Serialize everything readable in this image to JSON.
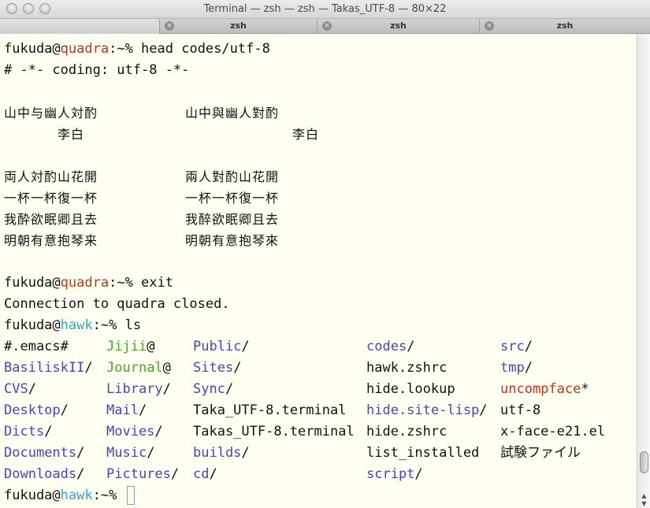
{
  "window": {
    "title": "Terminal — zsh — zsh — Takas_UTF-8 — 80×22"
  },
  "tabs": [
    {
      "label": ""
    },
    {
      "label": "zsh"
    },
    {
      "label": "zsh"
    },
    {
      "label": "zsh"
    }
  ],
  "session": {
    "user": "fukuda",
    "at": "@",
    "remote_host": "quadra",
    "local_host": "hawk",
    "prompt_suffix": ":~%",
    "cmd_head": " head codes/utf-8",
    "coding_line": "# -*- coding: utf-8 -*-",
    "cmd_exit": " exit",
    "connection_closed": "Connection to quadra closed.",
    "cmd_ls": " ls"
  },
  "poem": {
    "left": [
      "山中与幽人対酌",
      "　　　　李白",
      "",
      "両人対酌山花開",
      "一杯一杯復一杯",
      "我酔欲眠卿且去",
      "明朝有意抱琴来"
    ],
    "right": [
      "山中與幽人對酌",
      "　　　　　　　　李白",
      "",
      "兩人對酌山花開",
      "一杯一杯復一杯",
      "我醉欲眠卿且去",
      "明朝有意抱琴來"
    ]
  },
  "ls": {
    "rows": [
      [
        {
          "name": "#.emacs#",
          "suffix": "",
          "color": "black"
        },
        {
          "name": "Jijii",
          "suffix": "@",
          "color": "green"
        },
        {
          "name": "Public",
          "suffix": "/",
          "color": "blue"
        },
        {
          "name": "codes",
          "suffix": "/",
          "color": "blue"
        },
        {
          "name": "src",
          "suffix": "/",
          "color": "blue"
        }
      ],
      [
        {
          "name": "BasiliskII",
          "suffix": "/",
          "color": "blue"
        },
        {
          "name": "Journal",
          "suffix": "@",
          "color": "green"
        },
        {
          "name": "Sites",
          "suffix": "/",
          "color": "blue"
        },
        {
          "name": "hawk.zshrc",
          "suffix": "",
          "color": "black"
        },
        {
          "name": "tmp",
          "suffix": "/",
          "color": "blue"
        }
      ],
      [
        {
          "name": "CVS",
          "suffix": "/",
          "color": "blue"
        },
        {
          "name": "Library",
          "suffix": "/",
          "color": "blue"
        },
        {
          "name": "Sync",
          "suffix": "/",
          "color": "blue"
        },
        {
          "name": "hide.lookup",
          "suffix": "",
          "color": "black"
        },
        {
          "name": "uncompface",
          "suffix": "*",
          "color": "red"
        }
      ],
      [
        {
          "name": "Desktop",
          "suffix": "/",
          "color": "blue"
        },
        {
          "name": "Mail",
          "suffix": "/",
          "color": "blue"
        },
        {
          "name": "Taka_UTF-8.terminal",
          "suffix": "",
          "color": "black"
        },
        {
          "name": "hide.site-lisp",
          "suffix": "/",
          "color": "blue"
        },
        {
          "name": "utf-8",
          "suffix": "",
          "color": "black"
        }
      ],
      [
        {
          "name": "Dicts",
          "suffix": "/",
          "color": "blue"
        },
        {
          "name": "Movies",
          "suffix": "/",
          "color": "blue"
        },
        {
          "name": "Takas_UTF-8.terminal",
          "suffix": "",
          "color": "black"
        },
        {
          "name": "hide.zshrc",
          "suffix": "",
          "color": "black"
        },
        {
          "name": "x-face-e21.el",
          "suffix": "",
          "color": "black"
        }
      ],
      [
        {
          "name": "Documents",
          "suffix": "/",
          "color": "blue"
        },
        {
          "name": "Music",
          "suffix": "/",
          "color": "blue"
        },
        {
          "name": "builds",
          "suffix": "/",
          "color": "blue"
        },
        {
          "name": "list_installed",
          "suffix": "",
          "color": "black"
        },
        {
          "name": "試験ファイル",
          "suffix": "",
          "color": "black"
        }
      ],
      [
        {
          "name": "Downloads",
          "suffix": "/",
          "color": "blue"
        },
        {
          "name": "Pictures",
          "suffix": "/",
          "color": "blue"
        },
        {
          "name": "cd",
          "suffix": "/",
          "color": "blue"
        },
        {
          "name": "script",
          "suffix": "/",
          "color": "blue"
        },
        {
          "name": "",
          "suffix": "",
          "color": "black"
        }
      ]
    ]
  },
  "colors": {
    "background": "#fffff2",
    "remote_host": "#c6341d",
    "local_host": "#33aab9",
    "directory": "#4b3fd0",
    "symlink": "#3fae24",
    "executable": "#c6341d"
  },
  "icons": {
    "tab_close": "close-circle-icon",
    "traffic_lights": "window-button-icon"
  }
}
